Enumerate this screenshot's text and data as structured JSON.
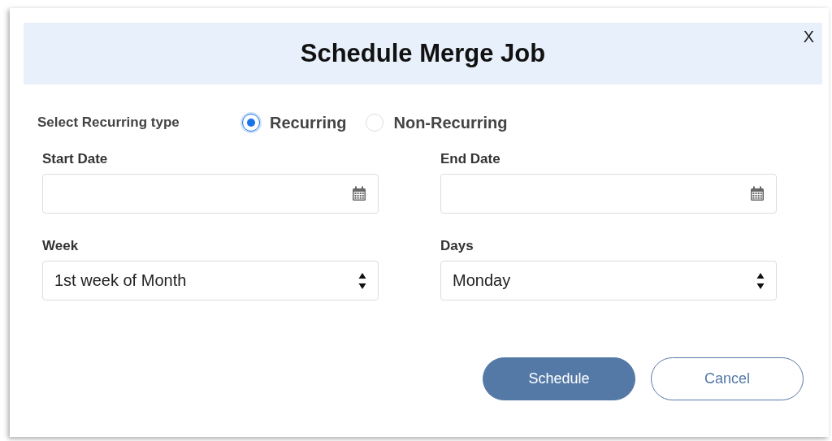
{
  "dialog": {
    "title": "Schedule Merge Job",
    "close": "X"
  },
  "recurring_type": {
    "label": "Select Recurring type",
    "options": [
      {
        "label": "Recurring",
        "selected": true
      },
      {
        "label": "Non-Recurring",
        "selected": false
      }
    ]
  },
  "fields": [
    {
      "kind": "date",
      "label": "Start Date"
    },
    {
      "kind": "date",
      "label": "End Date"
    },
    {
      "kind": "select",
      "label": "Week",
      "value": "1st week of Month"
    },
    {
      "kind": "select",
      "label": "Days",
      "value": "Monday"
    }
  ],
  "buttons": [
    {
      "kind": "primary",
      "label": "Schedule"
    },
    {
      "kind": "secondary",
      "label": "Cancel"
    }
  ]
}
